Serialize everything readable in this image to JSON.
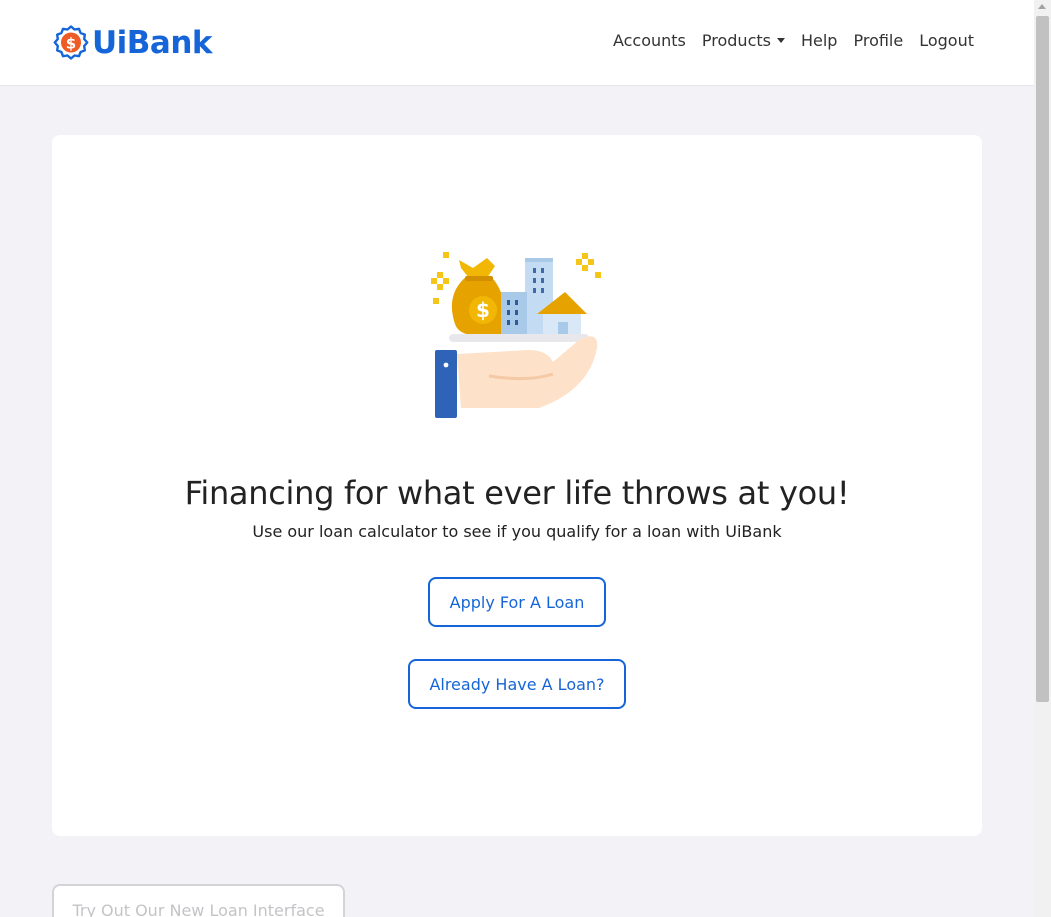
{
  "brand": {
    "name": "UiBank",
    "logo_icon": "dollar-badge-icon",
    "color": "#1665d8",
    "accent": "#ef5b25"
  },
  "nav": {
    "items": [
      {
        "label": "Accounts"
      },
      {
        "label": "Products"
      },
      {
        "label": "Help"
      },
      {
        "label": "Profile"
      },
      {
        "label": "Logout"
      }
    ]
  },
  "hero": {
    "illustration_icon": "hand-holding-money-bag-and-buildings-icon",
    "headline": "Financing for what ever life throws at you!",
    "subline": "Use our loan calculator to see if you qualify for a loan with UiBank"
  },
  "actions": {
    "apply_label": "Apply For A Loan",
    "already_label": "Already Have A Loan?",
    "new_interface_label": "Try Out Our New Loan Interface"
  },
  "colors": {
    "primary": "#1665d8",
    "page_bg": "#f3f3f7",
    "card_bg": "#ffffff"
  }
}
